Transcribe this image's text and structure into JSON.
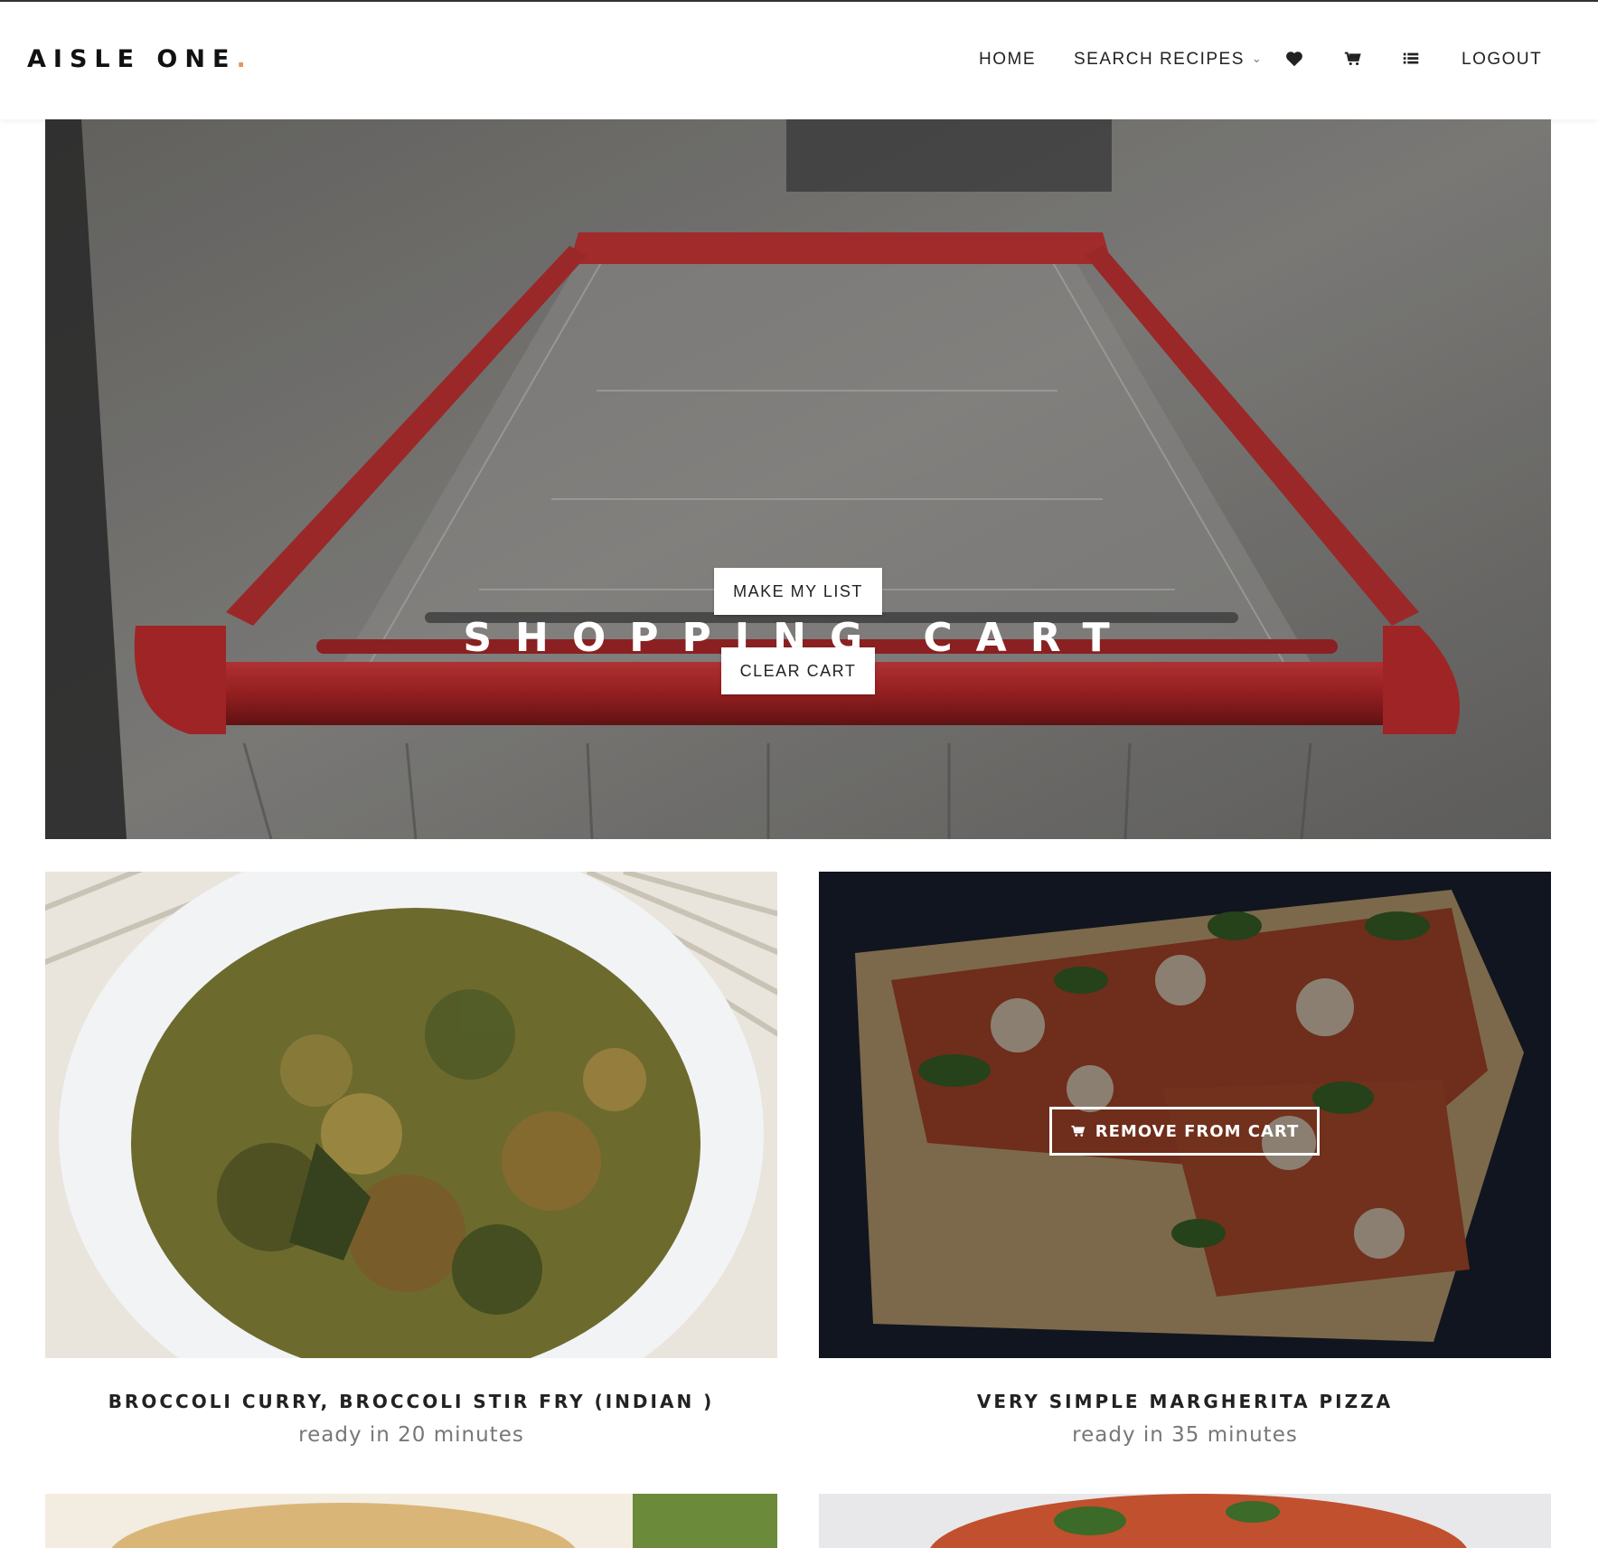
{
  "brand": {
    "name": "AISLE ONE",
    "dot": "."
  },
  "nav": {
    "home": "HOME",
    "search_recipes": "SEARCH RECIPES",
    "logout": "LOGOUT",
    "icons": [
      "heart-icon",
      "cart-icon",
      "list-icon"
    ]
  },
  "hero": {
    "title": "SHOPPING CART",
    "make_list_label": "MAKE MY LIST",
    "clear_cart_label": "CLEAR CART"
  },
  "recipes": [
    {
      "title": "BROCCOLI CURRY, BROCCOLI STIR FRY (INDIAN )",
      "ready": "ready in 20 minutes"
    },
    {
      "title": "VERY SIMPLE MARGHERITA PIZZA",
      "ready": "ready in 35 minutes",
      "action_label": "REMOVE FROM CART"
    }
  ],
  "colors": {
    "accent_dot": "#e8955b",
    "cart_red": "#b8282a"
  }
}
